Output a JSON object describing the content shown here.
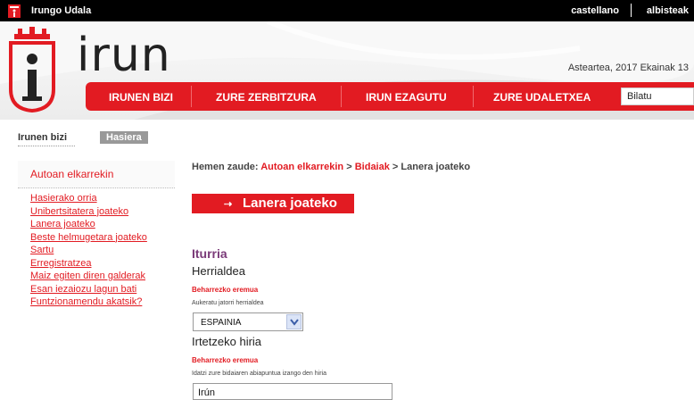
{
  "topbar": {
    "site_name": "Irungo Udala",
    "lang_link": "castellano",
    "news_link": "albisteak"
  },
  "header": {
    "wordmark": "irun",
    "date": "Asteartea, 2017 Ekainak 13"
  },
  "nav": {
    "items": [
      "IRUNEN BIZI",
      "ZURE ZERBITZURA",
      "IRUN EZAGUTU",
      "ZURE UDALETXEA"
    ],
    "search_value": "Bilatu"
  },
  "left_crumbs": {
    "first": "Irunen bizi",
    "second": "Hasiera"
  },
  "sidebar": {
    "title": "Autoan elkarrekin",
    "links": [
      "Hasierako orria",
      "Unibertsitatera joateko",
      "Lanera joateko",
      "Beste helmugetara joateko",
      "Sartu",
      "Erregistratzea",
      "Maiz egiten diren galderak",
      "Esan iezaiozu lagun bati",
      "Funtzionamendu akatsik?"
    ]
  },
  "breadcrumb": {
    "prefix": "Hemen zaude:",
    "link1": "Autoan elkarrekin",
    "sep1": ">",
    "link2": "Bidaiak",
    "sep2": ">",
    "current": "Lanera joateko"
  },
  "banner": {
    "arrow": "⇢",
    "title": "Lanera joateko"
  },
  "form": {
    "section": "Iturria",
    "field1_label": "Herrialdea",
    "field1_required": "Beharrezko eremua",
    "field1_hint": "Aukeratu jatorri herrialdea",
    "field1_value": "ESPAINIA",
    "field2_label": "Irtetzeko hiria",
    "field2_required": "Beharrezko eremua",
    "field2_hint": "Idatzi zure bidaiaren abiapuntua izango den hiria",
    "field2_value": "Irún"
  },
  "colors": {
    "accent": "#e21b22",
    "section": "#7a3a78"
  }
}
